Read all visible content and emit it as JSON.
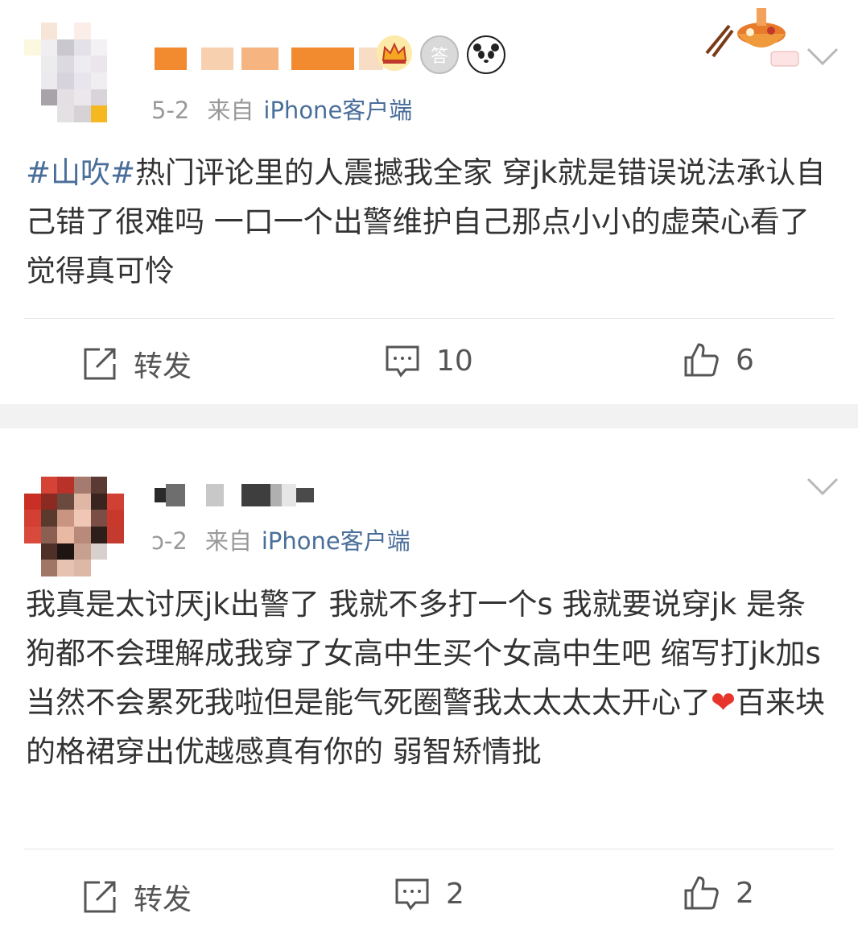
{
  "posts": [
    {
      "timestamp": "5-2",
      "source_prefix": "来自",
      "source": "iPhone客户端",
      "hashtag": "#山吹#",
      "text": "热门评论里的人震撼我全家 穿jk就是错误说法承认自己错了很难吗 一口一个出警维护自己那点小小的虚荣心看了觉得真可怜",
      "repost_label": "转发",
      "comments": "10",
      "likes": "6"
    },
    {
      "timestamp": "ɔ-2",
      "source_prefix": "来自",
      "source": "iPhone客户端",
      "text_before_heart": "我真是太讨厌jk出警了 我就不多打一个s 我就要说穿jk 是条狗都不会理解成我穿了女高中生买个女高中生吧 缩写打jk加s当然不会累死我啦但是能气死圈警我太太太太开心了",
      "heart": "❤",
      "text_after_heart": "百来块的格裙穿出优越感真有你的 弱智矫情批",
      "repost_label": "转发",
      "comments": "2",
      "likes": "2"
    }
  ],
  "badges": [
    "crown-badge",
    "answer-badge",
    "panda-badge"
  ],
  "badge_text": "答",
  "colors": {
    "link": "#4a6e9a",
    "meta": "#999999",
    "body": "#333333",
    "separator": "#f2f2f2",
    "heart": "#e8352b"
  }
}
